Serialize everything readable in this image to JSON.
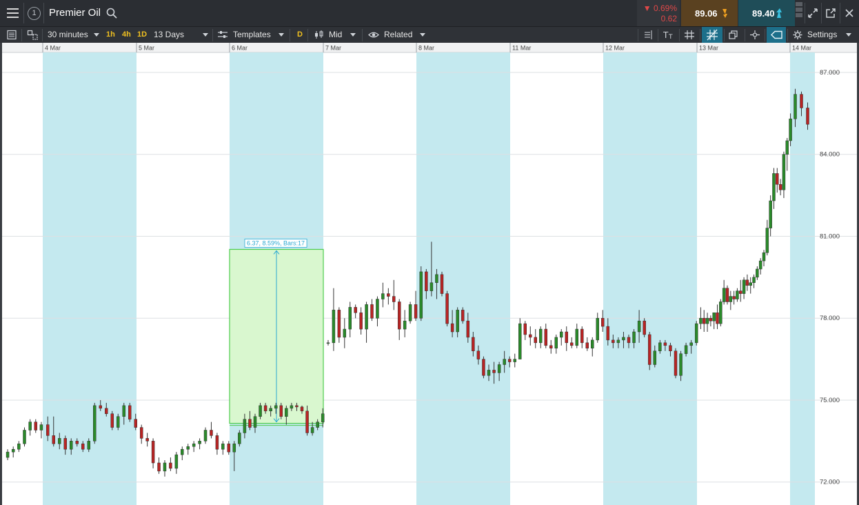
{
  "header": {
    "instrument_number": "1",
    "title": "Premier Oil",
    "change_pct": "▼ 0.69%",
    "change_abs": "0.62",
    "sell_price": "89.06",
    "buy_price": "89.40"
  },
  "toolbar": {
    "interval": "30 minutes",
    "q1": "1h",
    "q2": "4h",
    "q3": "1D",
    "range": "13 Days",
    "templates": "Templates",
    "d_label": "D",
    "price_type": "Mid",
    "related": "Related",
    "settings": "Settings"
  },
  "colors": {
    "up": "#2a8a2a",
    "down": "#b82424",
    "weekday_band": "#c4e9ef",
    "measure_fill": "#d9f7cf",
    "measure_stroke": "#4ccc4c",
    "measure_arrow": "#2aa9d2"
  },
  "chart_data": {
    "type": "candlestick",
    "title": "",
    "x_tick_labels": [
      "4 Mar",
      "5 Mar",
      "6 Mar",
      "7 Mar",
      "8 Mar",
      "11 Mar",
      "12 Mar",
      "13 Mar",
      "14 Mar"
    ],
    "y_tick_labels": [
      "87.000",
      "84.000",
      "81.000",
      "78.000",
      "75.000",
      "72.000"
    ],
    "y_ticks": [
      87,
      84,
      81,
      78,
      75,
      72
    ],
    "ylim": [
      71.5,
      88.1
    ],
    "grid": true,
    "measure": {
      "label": "6.37, 8.59%, Bars:17",
      "from_value": 74.15,
      "to_value": 80.52,
      "start_day_index": 3,
      "bars": 17
    },
    "days": [
      {
        "label": "",
        "candles": [
          [
            72.9,
            73.2,
            72.8,
            73.1
          ],
          [
            73.1,
            73.3,
            72.9,
            73.2
          ],
          [
            73.2,
            73.5,
            73.1,
            73.4
          ],
          [
            73.4,
            74.0,
            73.3,
            73.9
          ],
          [
            73.9,
            74.3,
            73.7,
            74.2
          ],
          [
            74.2,
            74.3,
            73.8,
            73.9
          ],
          [
            73.9,
            74.2,
            73.6,
            74.1
          ]
        ]
      },
      {
        "label": "4 Mar",
        "candles": [
          [
            74.1,
            74.4,
            73.5,
            73.7
          ],
          [
            73.7,
            74.4,
            73.3,
            73.4
          ],
          [
            73.4,
            73.8,
            73.2,
            73.6
          ],
          [
            73.6,
            73.7,
            73.0,
            73.2
          ],
          [
            73.2,
            73.6,
            73.0,
            73.5
          ],
          [
            73.5,
            73.6,
            73.3,
            73.4
          ],
          [
            73.4,
            73.5,
            73.1,
            73.2
          ],
          [
            73.2,
            73.6,
            73.1,
            73.5
          ],
          [
            73.5,
            74.9,
            73.4,
            74.8
          ],
          [
            74.8,
            75.0,
            74.6,
            74.7
          ],
          [
            74.7,
            74.9,
            74.4,
            74.5
          ],
          [
            74.5,
            74.6,
            73.9,
            74.0
          ],
          [
            74.0,
            74.5,
            73.9,
            74.4
          ],
          [
            74.4,
            74.9,
            74.1,
            74.8
          ],
          [
            74.8,
            74.9,
            74.2,
            74.3
          ],
          [
            74.3,
            74.5,
            73.9,
            74.0
          ]
        ]
      },
      {
        "label": "5 Mar",
        "candles": [
          [
            74.0,
            74.1,
            73.4,
            73.6
          ],
          [
            73.6,
            73.8,
            73.3,
            73.5
          ],
          [
            73.5,
            73.6,
            72.5,
            72.7
          ],
          [
            72.7,
            72.9,
            72.3,
            72.4
          ],
          [
            72.4,
            72.8,
            72.2,
            72.7
          ],
          [
            72.7,
            72.9,
            72.4,
            72.5
          ],
          [
            72.5,
            73.1,
            72.3,
            73.0
          ],
          [
            73.0,
            73.3,
            72.8,
            73.2
          ],
          [
            73.2,
            73.4,
            73.0,
            73.3
          ],
          [
            73.3,
            73.5,
            73.1,
            73.4
          ],
          [
            73.4,
            73.6,
            73.2,
            73.5
          ],
          [
            73.5,
            74.0,
            73.4,
            73.9
          ],
          [
            73.9,
            74.2,
            73.6,
            73.7
          ],
          [
            73.7,
            73.8,
            73.0,
            73.2
          ],
          [
            73.2,
            73.5,
            73.0,
            73.4
          ],
          [
            73.4,
            73.5,
            73.0,
            73.1
          ]
        ]
      },
      {
        "label": "6 Mar",
        "candles": [
          [
            73.1,
            73.5,
            72.4,
            73.4
          ],
          [
            73.4,
            73.9,
            73.3,
            73.8
          ],
          [
            73.8,
            74.5,
            73.6,
            74.3
          ],
          [
            74.3,
            74.6,
            73.9,
            74.0
          ],
          [
            74.0,
            74.5,
            73.8,
            74.4
          ],
          [
            74.4,
            74.9,
            74.3,
            74.8
          ],
          [
            74.8,
            74.9,
            74.5,
            74.6
          ],
          [
            74.6,
            74.8,
            74.4,
            74.7
          ],
          [
            74.7,
            74.9,
            74.5,
            74.8
          ],
          [
            74.8,
            74.9,
            74.3,
            74.4
          ],
          [
            74.4,
            74.8,
            74.1,
            74.7
          ],
          [
            74.7,
            74.9,
            74.6,
            74.8
          ],
          [
            74.8,
            74.9,
            74.6,
            74.75
          ],
          [
            74.75,
            74.8,
            74.5,
            74.6
          ],
          [
            74.6,
            74.8,
            73.7,
            73.8
          ],
          [
            73.8,
            74.2,
            73.7,
            74.0
          ],
          [
            74.0,
            74.3,
            73.9,
            74.2
          ],
          [
            74.2,
            74.7,
            74.0,
            74.5
          ]
        ]
      },
      {
        "label": "7 Mar",
        "candles": [
          [
            77.1,
            77.2,
            77.0,
            77.1
          ],
          [
            77.1,
            79.1,
            76.8,
            78.3
          ],
          [
            78.3,
            78.4,
            77.1,
            77.3
          ],
          [
            77.3,
            78.0,
            76.9,
            77.6
          ],
          [
            77.6,
            78.6,
            77.3,
            78.4
          ],
          [
            78.4,
            78.5,
            78.0,
            78.2
          ],
          [
            78.2,
            78.4,
            77.4,
            77.6
          ],
          [
            77.6,
            78.6,
            77.1,
            78.5
          ],
          [
            78.5,
            78.7,
            77.9,
            78.0
          ],
          [
            78.0,
            78.8,
            77.7,
            78.7
          ],
          [
            78.7,
            79.3,
            78.4,
            78.9
          ],
          [
            78.9,
            79.1,
            78.5,
            78.8
          ],
          [
            78.8,
            79.4,
            78.3,
            78.6
          ],
          [
            78.6,
            78.7,
            77.2,
            77.6
          ],
          [
            77.6,
            78.3,
            77.3,
            77.9
          ],
          [
            77.9,
            78.6,
            77.8,
            78.5
          ],
          [
            78.5,
            79.0,
            77.9,
            78.0
          ]
        ]
      },
      {
        "label": "8 Mar",
        "candles": [
          [
            78.0,
            79.9,
            77.9,
            79.7
          ],
          [
            79.7,
            79.8,
            78.7,
            79.0
          ],
          [
            79.0,
            80.8,
            78.8,
            79.3
          ],
          [
            79.3,
            79.8,
            78.7,
            79.6
          ],
          [
            79.6,
            79.7,
            78.8,
            78.9
          ],
          [
            78.9,
            79.0,
            77.7,
            77.8
          ],
          [
            77.8,
            78.3,
            77.3,
            77.5
          ],
          [
            77.5,
            78.4,
            77.3,
            78.3
          ],
          [
            78.3,
            78.4,
            77.8,
            77.9
          ],
          [
            77.9,
            78.2,
            77.1,
            77.3
          ],
          [
            77.3,
            77.5,
            76.6,
            76.8
          ],
          [
            76.8,
            77.0,
            76.3,
            76.5
          ],
          [
            76.5,
            76.6,
            75.8,
            75.9
          ],
          [
            75.9,
            76.3,
            75.7,
            76.1
          ],
          [
            76.1,
            76.4,
            75.6,
            76.0
          ],
          [
            76.0,
            76.4,
            75.7,
            76.3
          ],
          [
            76.3,
            76.8,
            76.0,
            76.5
          ],
          [
            76.5,
            76.6,
            76.2,
            76.4
          ]
        ]
      },
      {
        "label": "11 Mar",
        "candles": [
          [
            76.4,
            76.7,
            76.2,
            76.5
          ],
          [
            76.5,
            78.0,
            76.5,
            77.8
          ],
          [
            77.8,
            77.9,
            77.2,
            77.4
          ],
          [
            77.4,
            77.7,
            77.0,
            77.3
          ],
          [
            77.3,
            77.6,
            76.9,
            77.1
          ],
          [
            77.1,
            77.7,
            76.9,
            77.6
          ],
          [
            77.6,
            77.8,
            76.9,
            77.0
          ],
          [
            77.0,
            77.2,
            76.7,
            76.9
          ],
          [
            76.9,
            77.4,
            76.7,
            77.3
          ],
          [
            77.3,
            77.6,
            77.0,
            77.5
          ],
          [
            77.5,
            77.7,
            76.8,
            77.1
          ],
          [
            77.1,
            77.3,
            76.9,
            77.0
          ],
          [
            77.0,
            77.8,
            76.9,
            77.6
          ],
          [
            77.6,
            77.7,
            76.9,
            77.1
          ],
          [
            77.1,
            77.3,
            76.8,
            76.9
          ],
          [
            76.9,
            77.3,
            76.6,
            77.2
          ],
          [
            77.2,
            78.2,
            77.1,
            78.0
          ],
          [
            78.0,
            78.3,
            77.5,
            77.7
          ]
        ]
      },
      {
        "label": "12 Mar",
        "candles": [
          [
            77.7,
            78.0,
            77.0,
            77.2
          ],
          [
            77.2,
            77.4,
            76.9,
            77.1
          ],
          [
            77.1,
            77.3,
            76.9,
            77.2
          ],
          [
            77.2,
            77.5,
            76.9,
            77.3
          ],
          [
            77.3,
            77.4,
            76.9,
            77.1
          ],
          [
            77.1,
            77.6,
            76.9,
            77.5
          ],
          [
            77.5,
            78.3,
            77.1,
            77.9
          ],
          [
            77.9,
            78.0,
            77.3,
            77.4
          ],
          [
            77.4,
            77.5,
            76.1,
            76.3
          ],
          [
            76.3,
            77.0,
            76.2,
            76.8
          ],
          [
            76.8,
            77.2,
            76.7,
            77.1
          ],
          [
            77.1,
            77.2,
            76.8,
            77.0
          ],
          [
            77.0,
            77.1,
            76.6,
            76.8
          ],
          [
            76.8,
            76.9,
            75.8,
            75.9
          ],
          [
            75.9,
            76.8,
            75.7,
            76.7
          ],
          [
            76.7,
            77.1,
            76.6,
            77.0
          ],
          [
            77.0,
            77.2,
            76.7,
            77.1
          ],
          [
            77.1,
            77.9,
            77.0,
            77.8
          ]
        ]
      },
      {
        "label": "13 Mar",
        "candles": [
          [
            77.8,
            78.4,
            77.6,
            78.0
          ],
          [
            78.0,
            78.3,
            77.5,
            77.8
          ],
          [
            77.8,
            78.2,
            77.5,
            78.0
          ],
          [
            78.0,
            78.1,
            77.7,
            77.9
          ],
          [
            77.9,
            78.1,
            77.6,
            78.2
          ],
          [
            78.2,
            78.5,
            77.6,
            77.8
          ],
          [
            77.8,
            78.7,
            77.7,
            78.6
          ],
          [
            78.6,
            79.4,
            78.5,
            79.1
          ],
          [
            79.1,
            79.2,
            78.5,
            78.6
          ],
          [
            78.6,
            79.0,
            78.3,
            78.8
          ],
          [
            78.8,
            79.0,
            78.5,
            78.7
          ],
          [
            78.7,
            79.1,
            78.6,
            79.0
          ],
          [
            79.0,
            79.4,
            78.6,
            78.9
          ],
          [
            78.9,
            79.5,
            78.7,
            79.4
          ],
          [
            79.4,
            79.6,
            79.0,
            79.2
          ],
          [
            79.2,
            79.5,
            78.9,
            79.3
          ],
          [
            79.3,
            79.6,
            79.1,
            79.5
          ],
          [
            79.5,
            79.9,
            79.4,
            79.8
          ],
          [
            79.8,
            80.2,
            79.6,
            80.1
          ],
          [
            80.1,
            80.5,
            79.9,
            80.4
          ],
          [
            80.4,
            81.6,
            80.3,
            81.3
          ],
          [
            81.3,
            82.5,
            81.0,
            82.3
          ],
          [
            82.3,
            83.5,
            82.0,
            83.3
          ],
          [
            83.3,
            83.5,
            82.6,
            82.9
          ],
          [
            82.9,
            83.1,
            82.5,
            82.7
          ],
          [
            82.7,
            84.1,
            82.4,
            84.0
          ],
          [
            84.0,
            84.6,
            83.4,
            84.5
          ],
          [
            84.5,
            85.5,
            84.3,
            85.3
          ]
        ]
      },
      {
        "label": "14 Mar",
        "candles": [
          [
            85.3,
            86.4,
            85.0,
            86.2
          ],
          [
            86.2,
            86.3,
            85.4,
            85.7
          ],
          [
            85.7,
            85.9,
            84.9,
            85.1
          ]
        ]
      }
    ]
  }
}
